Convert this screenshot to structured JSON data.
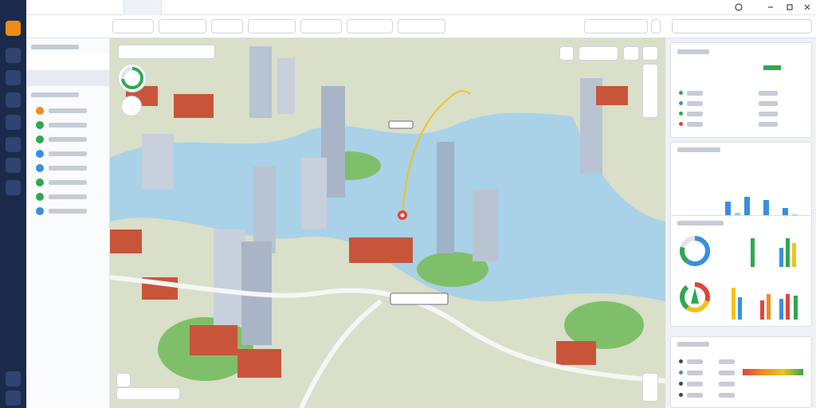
{
  "app": {
    "title": ""
  },
  "colors": {
    "rail": "#1b2a4a",
    "accent": "#1f6fd1",
    "water": "#a9d1e8",
    "land": "#d9dfc9",
    "park": "#7fbf6a",
    "building": "#b9c4d2",
    "roof_red": "#c8553a",
    "route": "#f0c419",
    "status_green": "#2fa84f",
    "status_orange": "#f08c1a",
    "status_blue": "#3a8fe0",
    "status_red": "#e0443a"
  },
  "rail": {
    "items": [
      "globe-icon",
      "layers-icon",
      "chart-icon",
      "gear-icon",
      "monitor-icon",
      "document-icon",
      "compass-icon",
      "settings-icon"
    ]
  },
  "sidebar": {
    "sections": [
      "",
      ""
    ],
    "items": [
      "",
      "",
      "",
      "",
      "",
      "",
      "",
      ""
    ]
  },
  "right_panel": {
    "kpi_card": {
      "title": "",
      "rows": [
        "",
        "",
        "",
        ""
      ]
    },
    "bar_chart": {
      "title": ""
    },
    "gauges": {
      "title": ""
    },
    "table_card": {
      "title": "",
      "rows": [
        "",
        "",
        "",
        ""
      ]
    }
  }
}
